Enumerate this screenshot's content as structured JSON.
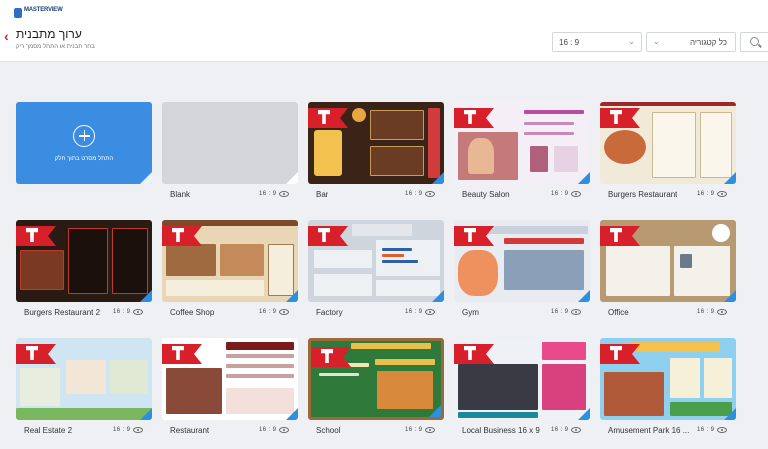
{
  "header": {
    "logo": "MASTERVIEW",
    "logo_sub": "",
    "title": "ערוך מתבנית",
    "subtitle": "בחר תבנית או התחל מסמך ריק",
    "ratio_select": "16 : 9",
    "category_select": "כל קטגוריה"
  },
  "new_template": {
    "label": "התחל מסרט בתוך חלק"
  },
  "templates": [
    {
      "name": "Blank",
      "ratio": "16 : 9"
    },
    {
      "name": "Bar",
      "ratio": "16 : 9"
    },
    {
      "name": "Beauty Salon",
      "ratio": "16 : 9"
    },
    {
      "name": "Burgers Restaurant",
      "ratio": "16 : 9"
    },
    {
      "name": "Burgers Restaurant 2",
      "ratio": "16 : 9"
    },
    {
      "name": "Coffee Shop",
      "ratio": "16 : 9"
    },
    {
      "name": "Factory",
      "ratio": "16 : 9"
    },
    {
      "name": "Gym",
      "ratio": "16 : 9"
    },
    {
      "name": "Office",
      "ratio": "16 : 9"
    },
    {
      "name": "Real Estate 2",
      "ratio": "16 : 9"
    },
    {
      "name": "Restaurant",
      "ratio": "16 : 9"
    },
    {
      "name": "School",
      "ratio": "16 : 9"
    },
    {
      "name": "Local Business 16 x 9",
      "ratio": "16 : 9"
    },
    {
      "name": "Amusement Park 16 ...",
      "ratio": "16 : 9"
    }
  ],
  "thumb_colors": {
    "bar": "#3a2418",
    "beauty": "#f4eef6",
    "burgers": "#f2ead8",
    "burgers2": "#2a1a14",
    "coffee": "#e9d6b4",
    "factory": "#cfd5dc",
    "gym": "#e8ebf0",
    "office": "#b79a72",
    "realestate": "#cfe6f2",
    "restaurant": "#ffffff",
    "school": "#2f7a3a",
    "localbiz": "#eef2f6",
    "amusement": "#8fd0f0",
    "accent": "#d8202b",
    "corner": "#2e8fe0"
  }
}
